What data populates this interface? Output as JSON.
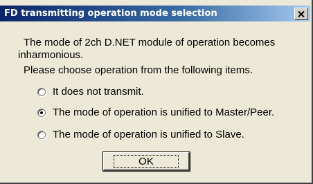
{
  "window": {
    "title": "FD transmitting operation mode selection",
    "close_icon": "close-x-icon"
  },
  "message": {
    "line1": "The mode of 2ch D.NET module of operation becomes",
    "line2": "inharmonious.",
    "line3": "Please choose operation from the following items."
  },
  "options": [
    {
      "label": "It does not transmit.",
      "selected": false
    },
    {
      "label": "The mode of operation is unified to Master/Peer.",
      "selected": true
    },
    {
      "label": "The mode of operation is unified to Slave.",
      "selected": false
    }
  ],
  "buttons": {
    "ok_label": "OK"
  }
}
